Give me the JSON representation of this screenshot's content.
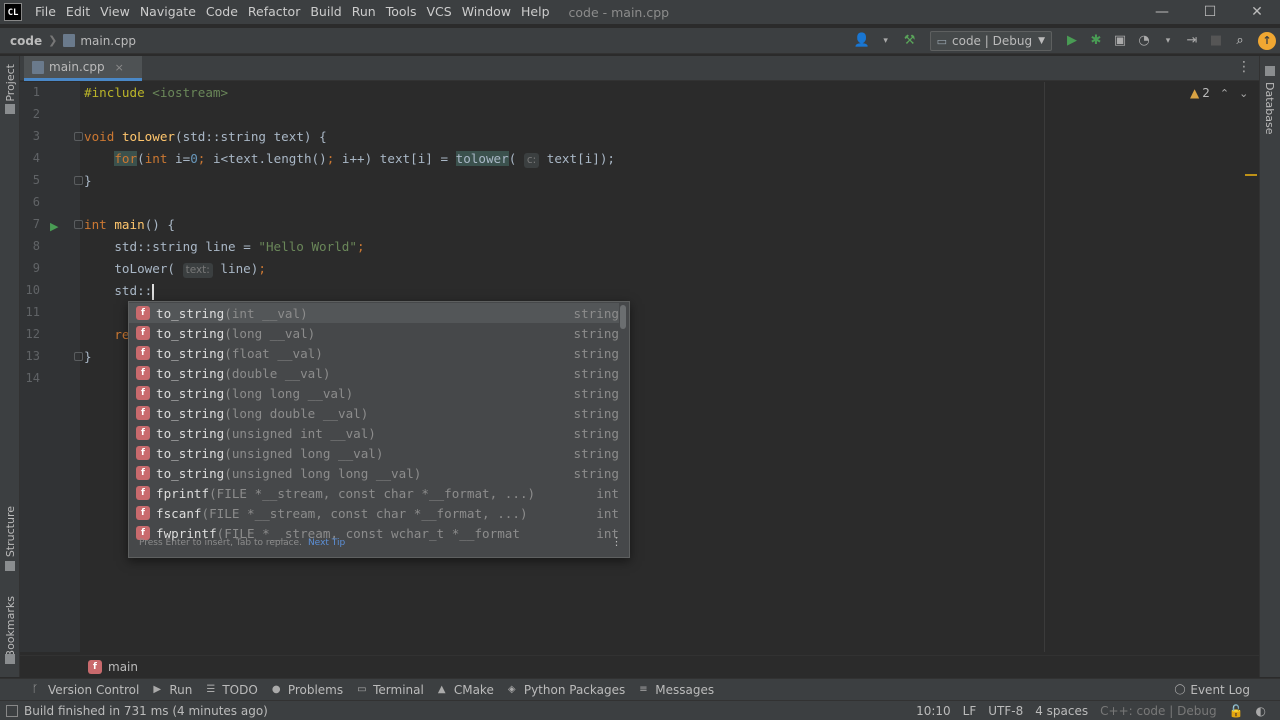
{
  "window": {
    "app_logo": "CL",
    "menu": [
      "File",
      "Edit",
      "View",
      "Navigate",
      "Code",
      "Refactor",
      "Build",
      "Run",
      "Tools",
      "VCS",
      "Window",
      "Help"
    ],
    "title": "code - main.cpp",
    "controls": {
      "minimize": "—",
      "maximize": "☐",
      "close": "✕"
    }
  },
  "navbar": {
    "project": "code",
    "file": "main.cpp",
    "run_config": "code | Debug",
    "icons": [
      "user-icon",
      "hammer-icon",
      "run-icon",
      "debug-icon",
      "coverage-icon",
      "profile-icon",
      "stop-icon",
      "search-icon",
      "update-icon"
    ]
  },
  "side_tabs": {
    "left": [
      "Project",
      "Structure",
      "Bookmarks"
    ],
    "right": [
      "Database"
    ]
  },
  "tabs": [
    {
      "label": "main.cpp",
      "close": "×"
    }
  ],
  "editor": {
    "line_numbers": [
      "1",
      "2",
      "3",
      "4",
      "5",
      "6",
      "7",
      "8",
      "9",
      "10",
      "11",
      "12",
      "13",
      "14"
    ],
    "lines": [
      {
        "n": 1,
        "text": "#include <iostream>"
      },
      {
        "n": 2,
        "text": ""
      },
      {
        "n": 3,
        "text": "void toLower(std::string text) {"
      },
      {
        "n": 4,
        "text": "    for(int i=0; i<text.length(); i++) text[i] = tolower( c: text[i]);"
      },
      {
        "n": 5,
        "text": "}"
      },
      {
        "n": 6,
        "text": ""
      },
      {
        "n": 7,
        "text": "int main() {"
      },
      {
        "n": 8,
        "text": "    std::string line = \"Hello World\";"
      },
      {
        "n": 9,
        "text": "    toLower( text: line);"
      },
      {
        "n": 10,
        "text": "    std::"
      },
      {
        "n": 11,
        "text": ""
      },
      {
        "n": 12,
        "text": "    re"
      },
      {
        "n": 13,
        "text": "}"
      },
      {
        "n": 14,
        "text": ""
      }
    ],
    "inspection_count": "2",
    "hints": {
      "tolower_param": "c:",
      "toLower_param": "text:"
    }
  },
  "completion": {
    "items": [
      {
        "name": "to_string",
        "params": "(int __val)",
        "type": "string"
      },
      {
        "name": "to_string",
        "params": "(long __val)",
        "type": "string"
      },
      {
        "name": "to_string",
        "params": "(float __val)",
        "type": "string"
      },
      {
        "name": "to_string",
        "params": "(double __val)",
        "type": "string"
      },
      {
        "name": "to_string",
        "params": "(long long __val)",
        "type": "string"
      },
      {
        "name": "to_string",
        "params": "(long double __val)",
        "type": "string"
      },
      {
        "name": "to_string",
        "params": "(unsigned int __val)",
        "type": "string"
      },
      {
        "name": "to_string",
        "params": "(unsigned long __val)",
        "type": "string"
      },
      {
        "name": "to_string",
        "params": "(unsigned long long __val)",
        "type": "string"
      },
      {
        "name": "fprintf",
        "params": "(FILE *__stream, const char *__format, ...)",
        "type": "int"
      },
      {
        "name": "fscanf",
        "params": "(FILE *__stream, const char *__format, ...)",
        "type": "int"
      },
      {
        "name": "fwprintf",
        "params": "(FILE *__stream, const wchar_t *__format",
        "type": "int"
      }
    ],
    "badge": "f",
    "footer_hint": "Press Enter to insert, Tab to replace.",
    "footer_tip": "Next Tip"
  },
  "breadcrumb": {
    "badge": "f",
    "label": "main"
  },
  "tool_windows": [
    "Version Control",
    "Run",
    "TODO",
    "Problems",
    "Terminal",
    "CMake",
    "Python Packages",
    "Messages"
  ],
  "event_log": "Event Log",
  "status": {
    "message": "Build finished in 731 ms (4 minutes ago)",
    "position": "10:10",
    "line_sep": "LF",
    "encoding": "UTF-8",
    "indent": "4 spaces",
    "context": "C++: code | Debug"
  }
}
